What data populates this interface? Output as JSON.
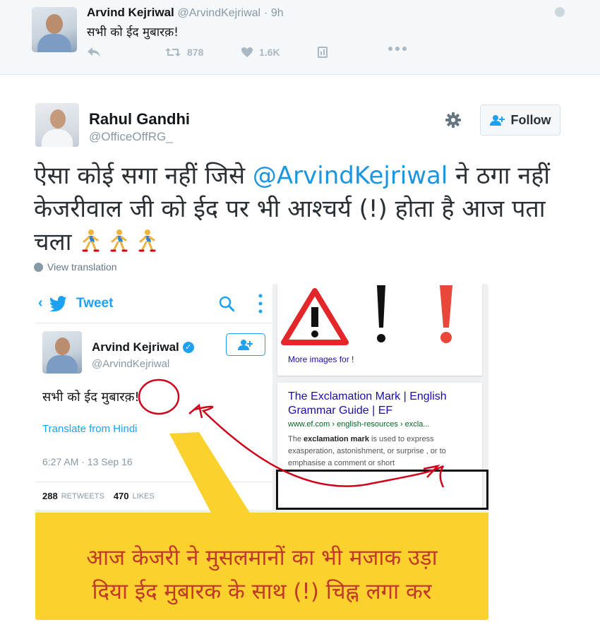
{
  "quoted_tweet": {
    "name": "Arvind Kejriwal",
    "handle": "@ArvindKejriwal",
    "separator": "·",
    "time": "9h",
    "text": "सभी को ईद मुबारक़!",
    "retweets": "878",
    "likes": "1.6K"
  },
  "tweet": {
    "name": "Rahul Gandhi",
    "handle": "@OfficeOffRG_",
    "follow_label": "Follow",
    "text_before": "ऐसा कोई सगा नहीं जिसे ",
    "mention": "@ArvindKejriwal",
    "text_after": " ने ठगा नहीं केजरीवाल जी को ईद पर भी आश्चर्य (!) होता है आज पता चला",
    "view_translation": "View translation"
  },
  "embedded_image": {
    "app_title": "Tweet",
    "inner_name": "Arvind Kejriwal",
    "inner_handle": "@ArvindKejriwal",
    "inner_text": "सभी को ईद मुबारक़!",
    "translate_label": "Translate from Hindi",
    "date": "6:27 AM · 13 Sep 16",
    "retweets_count": "288",
    "retweets_caption": "RETWEETS",
    "likes_count": "470",
    "likes_caption": "LIKES",
    "more_images": "More images for !",
    "result_title": "The Exclamation Mark | English Grammar Guide | EF",
    "result_url": "www.ef.com › english-resources › excla...",
    "snippet_before": "The ",
    "snippet_bold": "exclamation mark",
    "snippet_after": " is used to express exasperation, astonishment, or surprise , or to emphasise a comment or short",
    "banner_line1": "आज केजरी ने मुसलमानों का भी मजाक उड़ा",
    "banner_line2": "दिया ईद मुबारक के साथ (!) चिह्न लगा कर"
  },
  "colors": {
    "link": "#1b95e0",
    "banner_bg": "#fbd12e",
    "banner_text": "#c0392b",
    "annotation_red": "#d0021b"
  }
}
